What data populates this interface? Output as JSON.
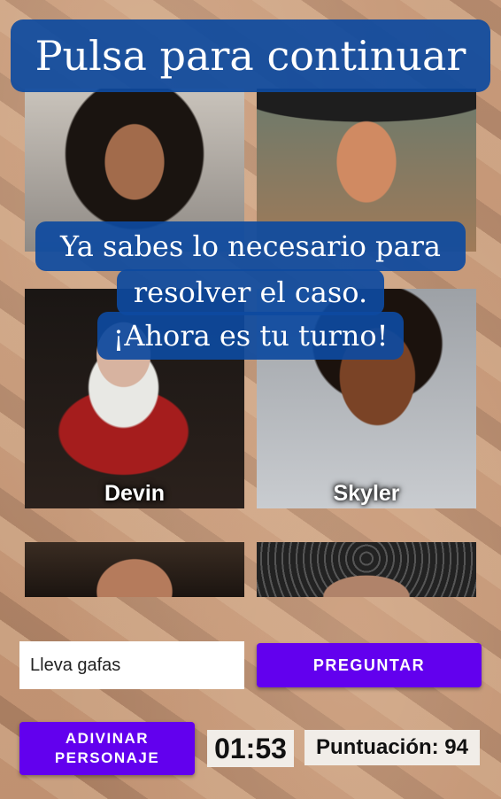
{
  "title": "Pulsa para continuar",
  "message": {
    "line1": "Ya sabes lo necesario para",
    "line2": "resolver el caso.",
    "line3": "¡Ahora es tu turno!"
  },
  "characters": [
    {
      "name": ""
    },
    {
      "name": ""
    },
    {
      "name": "Devin"
    },
    {
      "name": "Skyler"
    },
    {
      "name": ""
    },
    {
      "name": ""
    }
  ],
  "question_input": {
    "value": "Lleva gafas"
  },
  "ask_button_label": "PREGUNTAR",
  "guess_button_label": {
    "line1": "ADIVINAR",
    "line2": "PERSONAJE"
  },
  "timer": "01:53",
  "score_text": "Puntuación: 94",
  "colors": {
    "banner": "#0d4aa0",
    "button": "#6200ee"
  }
}
